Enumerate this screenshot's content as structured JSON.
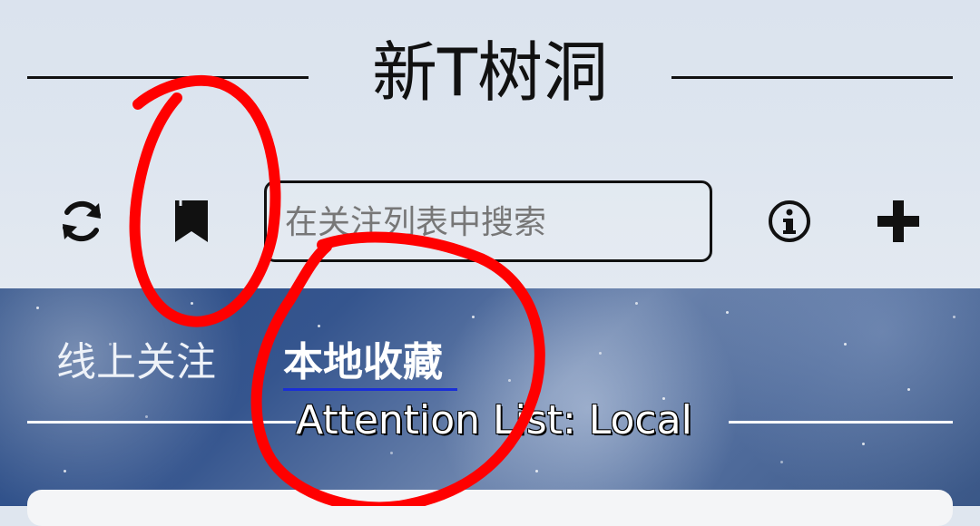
{
  "header": {
    "title": "新T树洞"
  },
  "toolbar": {
    "refresh_icon": "refresh-icon",
    "bookmark_icon": "bookmark-icon",
    "info_icon": "info-icon",
    "add_icon": "plus-icon"
  },
  "search": {
    "placeholder": "在关注列表中搜索",
    "value": ""
  },
  "tabs": [
    {
      "label": "线上关注",
      "selected": false
    },
    {
      "label": "本地收藏",
      "selected": true
    }
  ],
  "list": {
    "subtitle": "Attention List: Local"
  },
  "colors": {
    "tab_underline": "#1a2fd6",
    "annotation": "#ff0000"
  }
}
